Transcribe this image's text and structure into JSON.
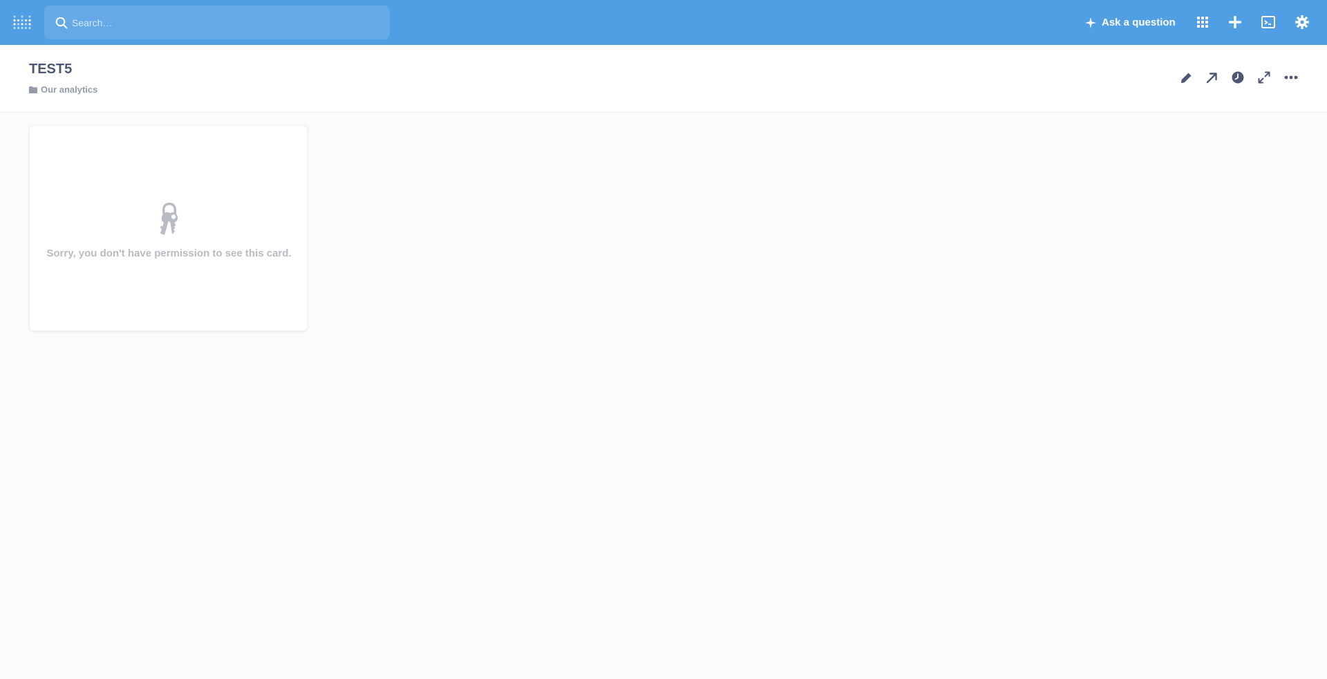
{
  "navbar": {
    "background": "#509ee3",
    "search": {
      "placeholder": "Search…",
      "value": ""
    },
    "ask_question_label": "Ask a question",
    "icons": [
      "grid-icon",
      "plus-icon",
      "snippet-icon",
      "gear-icon"
    ]
  },
  "dashboard": {
    "title": "TEST5",
    "collection": "Our analytics",
    "actions": [
      "pencil-icon",
      "share-arrow-icon",
      "history-clock-icon",
      "fullscreen-icon",
      "more-icon"
    ]
  },
  "card": {
    "message": "Sorry, you don't have permission to see this card.",
    "icon": "keys-icon"
  }
}
